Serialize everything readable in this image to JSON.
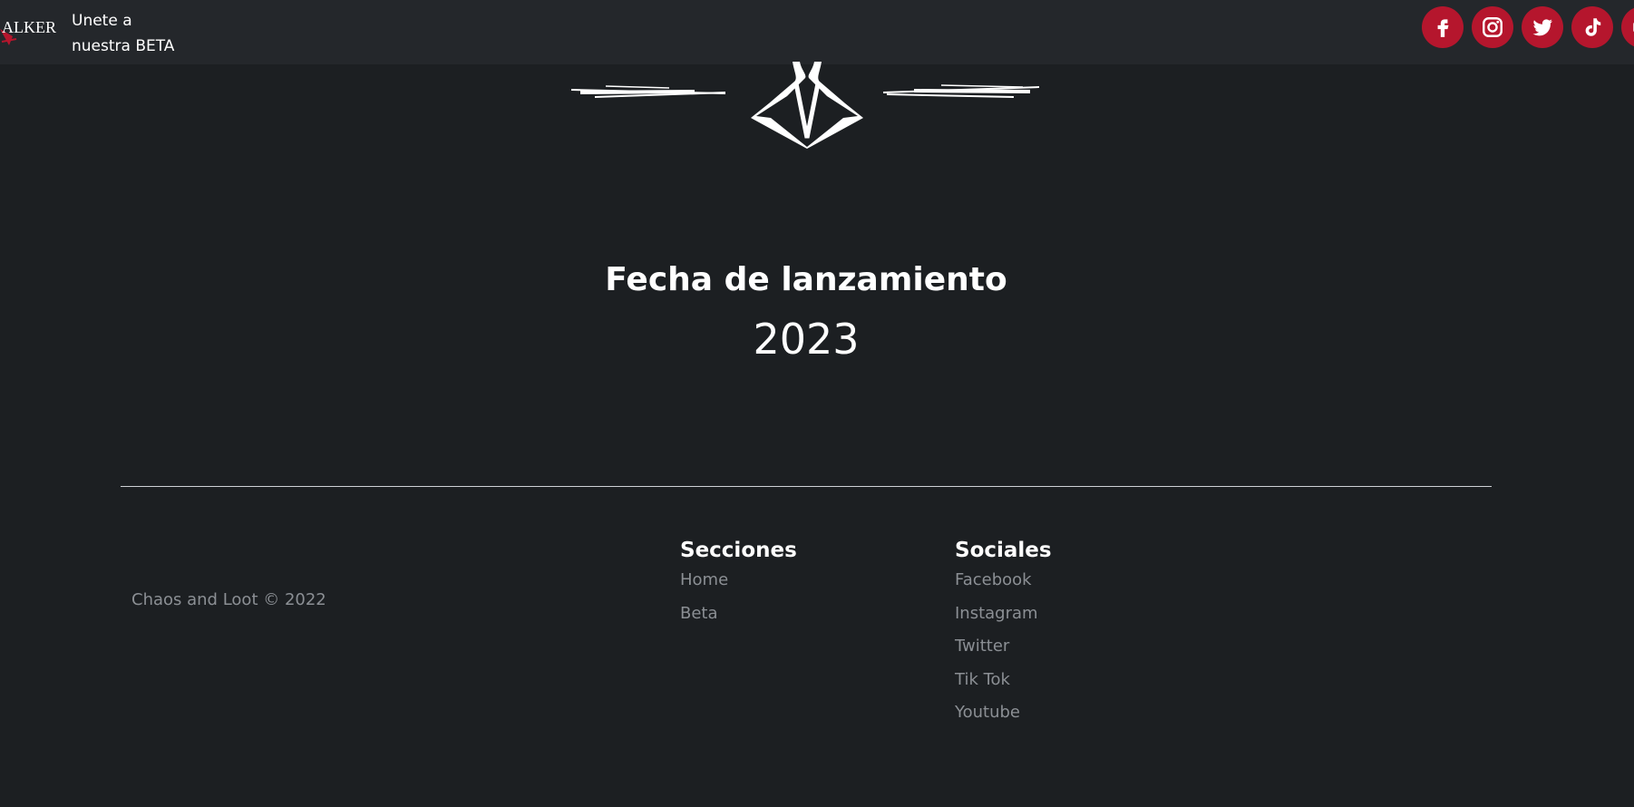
{
  "navbar": {
    "brand_text": "ALKERS",
    "beta_link_line1": "Unete a",
    "beta_link_line2": "nuestra BETA",
    "social_icons": [
      "facebook-icon",
      "instagram-icon",
      "twitter-icon",
      "tiktok-icon",
      "youtube-icon"
    ],
    "accent_color": "#b5162d"
  },
  "hero": {
    "emblem_icon": "skull-emblem-icon",
    "launch_title": "Fecha de lanzamiento",
    "launch_year": "2023"
  },
  "footer": {
    "copyright": "Chaos and Loot © 2022",
    "secciones": {
      "heading": "Secciones",
      "links": [
        "Home",
        "Beta"
      ]
    },
    "sociales": {
      "heading": "Sociales",
      "links": [
        "Facebook",
        "Instagram",
        "Twitter",
        "Tik Tok",
        "Youtube"
      ]
    }
  },
  "colors": {
    "background": "#1c1f22",
    "navbar": "#24272b",
    "muted_text": "#8b8f94"
  }
}
